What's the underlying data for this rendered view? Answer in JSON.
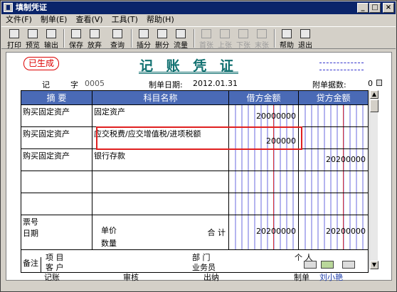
{
  "window": {
    "title": "填制凭证"
  },
  "menu": [
    "文件(F)",
    "制单(E)",
    "查看(V)",
    "工具(T)",
    "帮助(H)"
  ],
  "toolbar": [
    {
      "label": "打印",
      "icon": "printer-icon",
      "enabled": true
    },
    {
      "label": "预览",
      "icon": "preview-icon",
      "enabled": true
    },
    {
      "label": "输出",
      "icon": "export-icon",
      "enabled": true
    },
    {
      "label": "保存",
      "icon": "save-icon",
      "enabled": true
    },
    {
      "label": "放弃",
      "icon": "undo-icon",
      "enabled": true
    },
    {
      "label": "查询",
      "icon": "binoculars-icon",
      "enabled": true
    },
    {
      "label": "插分",
      "icon": "insert-row-icon",
      "enabled": true
    },
    {
      "label": "删分",
      "icon": "delete-row-icon",
      "enabled": true
    },
    {
      "label": "流量",
      "icon": "cashflow-icon",
      "enabled": true
    },
    {
      "label": "首张",
      "icon": "first-record-icon",
      "enabled": false
    },
    {
      "label": "上张",
      "icon": "prev-record-icon",
      "enabled": false
    },
    {
      "label": "下张",
      "icon": "next-record-icon",
      "enabled": false
    },
    {
      "label": "末张",
      "icon": "last-record-icon",
      "enabled": false
    },
    {
      "label": "帮助",
      "icon": "help-icon",
      "enabled": true
    },
    {
      "label": "退出",
      "icon": "exit-icon",
      "enabled": true
    }
  ],
  "voucher": {
    "status_stamp": "已生成",
    "title": "记 账 凭 证",
    "type_label": "记",
    "zi_label": "字",
    "number": "0005",
    "date_label": "制单日期:",
    "date": "2012.01.31",
    "attach_label": "附单据数:",
    "attach_value": "0",
    "headers": {
      "summary": "摘 要",
      "account": "科目名称",
      "debit": "借方金额",
      "credit": "贷方金额"
    },
    "rows": [
      {
        "summary": "购买固定资产",
        "account": "固定资产",
        "debit": "20000000",
        "credit": ""
      },
      {
        "summary": "购买固定资产",
        "account": "应交税费/应交增值税/进项税额",
        "debit": "200000",
        "credit": ""
      },
      {
        "summary": "购买固定资产",
        "account": "银行存款",
        "debit": "",
        "credit": "20200000"
      },
      {
        "summary": "",
        "account": "",
        "debit": "",
        "credit": ""
      },
      {
        "summary": "",
        "account": "",
        "debit": "",
        "credit": ""
      }
    ],
    "ticket_no_label": "票号",
    "date_row_label": "日期",
    "unit_price_label": "单价",
    "quantity_label": "数量",
    "total_label": "合 计",
    "total_debit": "20200000",
    "total_credit": "20200000",
    "remarks_label": "备注",
    "project_label": "项 目",
    "customer_label": "客 户",
    "department_label": "部 门",
    "salesperson_label": "业务员",
    "person_label": "个 人"
  },
  "footer": {
    "bookkeeping": "记账",
    "review": "审核",
    "cashier": "出纳",
    "maker_label": "制单",
    "maker_name": "刘小艳"
  }
}
